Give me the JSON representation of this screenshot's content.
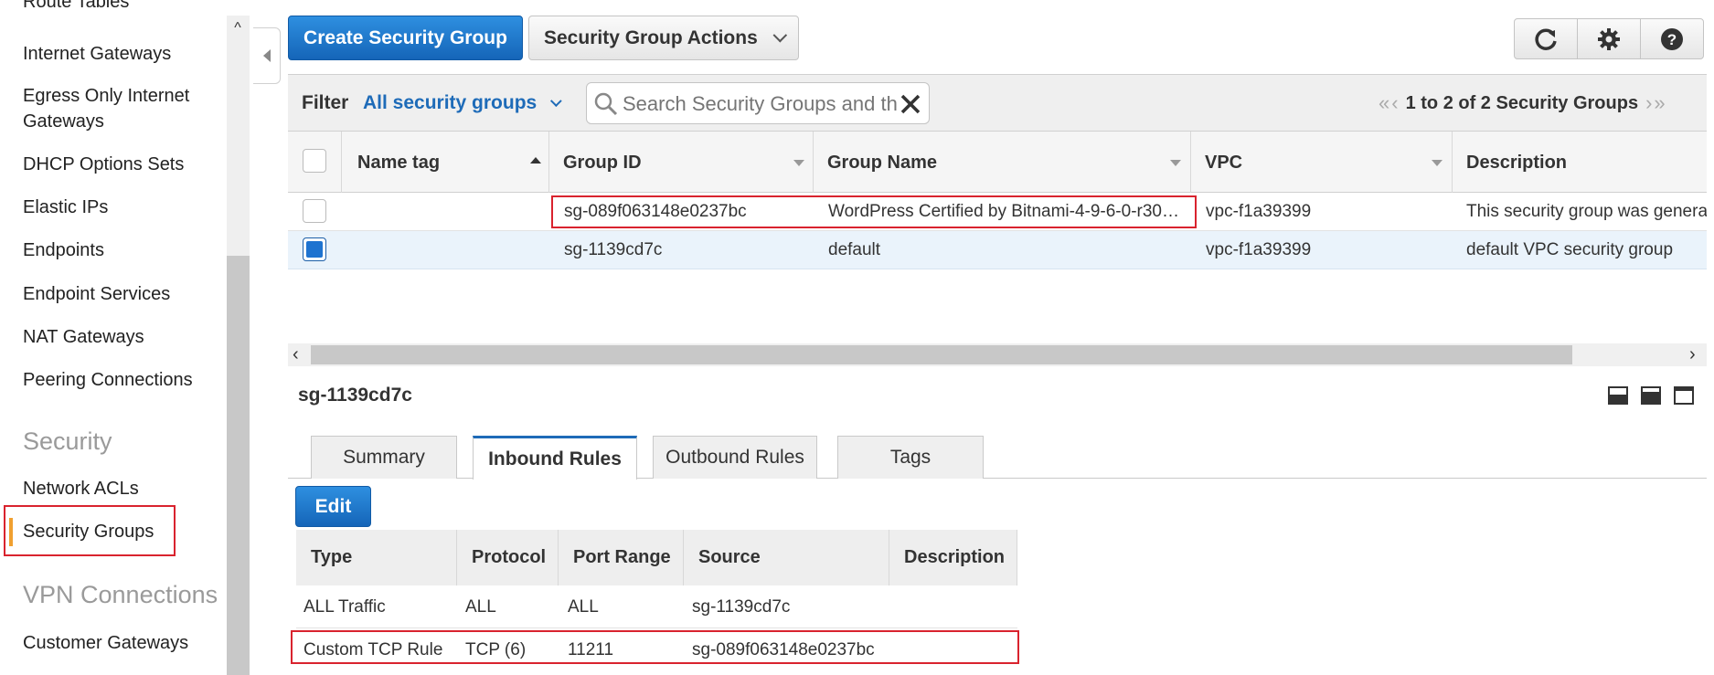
{
  "sidebar": {
    "items": [
      {
        "label": "Route Tables"
      },
      {
        "label": "Internet Gateways"
      },
      {
        "label": "Egress Only Internet Gateways"
      },
      {
        "label": "DHCP Options Sets"
      },
      {
        "label": "Elastic IPs"
      },
      {
        "label": "Endpoints"
      },
      {
        "label": "Endpoint Services"
      },
      {
        "label": "NAT Gateways"
      },
      {
        "label": "Peering Connections"
      }
    ],
    "security_heading": "Security",
    "security_items": [
      {
        "label": "Network ACLs"
      },
      {
        "label": "Security Groups"
      }
    ],
    "vpn_heading": "VPN Connections",
    "vpn_items": [
      {
        "label": "Customer Gateways"
      }
    ]
  },
  "toolbar": {
    "create_label": "Create Security Group",
    "actions_label": "Security Group Actions"
  },
  "filter": {
    "label": "Filter",
    "value": "All security groups",
    "search_placeholder": "Search Security Groups and their properties",
    "pagination": "1 to 2 of 2 Security Groups"
  },
  "table": {
    "columns": [
      "Name tag",
      "Group ID",
      "Group Name",
      "VPC",
      "Description"
    ],
    "rows": [
      {
        "name_tag": "",
        "group_id": "sg-089f063148e0237bc",
        "group_name": "WordPress Certified by Bitnami-4-9-6-0-r30…",
        "vpc": "vpc-f1a39399",
        "description": "This security group was genera",
        "selected": false
      },
      {
        "name_tag": "",
        "group_id": "sg-1139cd7c",
        "group_name": "default",
        "vpc": "vpc-f1a39399",
        "description": "default VPC security group",
        "selected": true
      }
    ]
  },
  "detail": {
    "title": "sg-1139cd7c",
    "tabs": [
      "Summary",
      "Inbound Rules",
      "Outbound Rules",
      "Tags"
    ],
    "active_tab": "Inbound Rules",
    "edit_label": "Edit",
    "rules_columns": [
      "Type",
      "Protocol",
      "Port Range",
      "Source",
      "Description"
    ],
    "rules": [
      {
        "type": "ALL Traffic",
        "protocol": "ALL",
        "port_range": "ALL",
        "source": "sg-1139cd7c",
        "description": ""
      },
      {
        "type": "Custom TCP Rule",
        "protocol": "TCP (6)",
        "port_range": "11211",
        "source": "sg-089f063148e0237bc",
        "description": ""
      }
    ]
  },
  "colors": {
    "primary_button": "#1a73c6",
    "highlight_box": "#d9232e",
    "active_nav_marker": "#f0a030",
    "selected_row": "#eaf3fb",
    "link_blue": "#1e6bb8"
  }
}
